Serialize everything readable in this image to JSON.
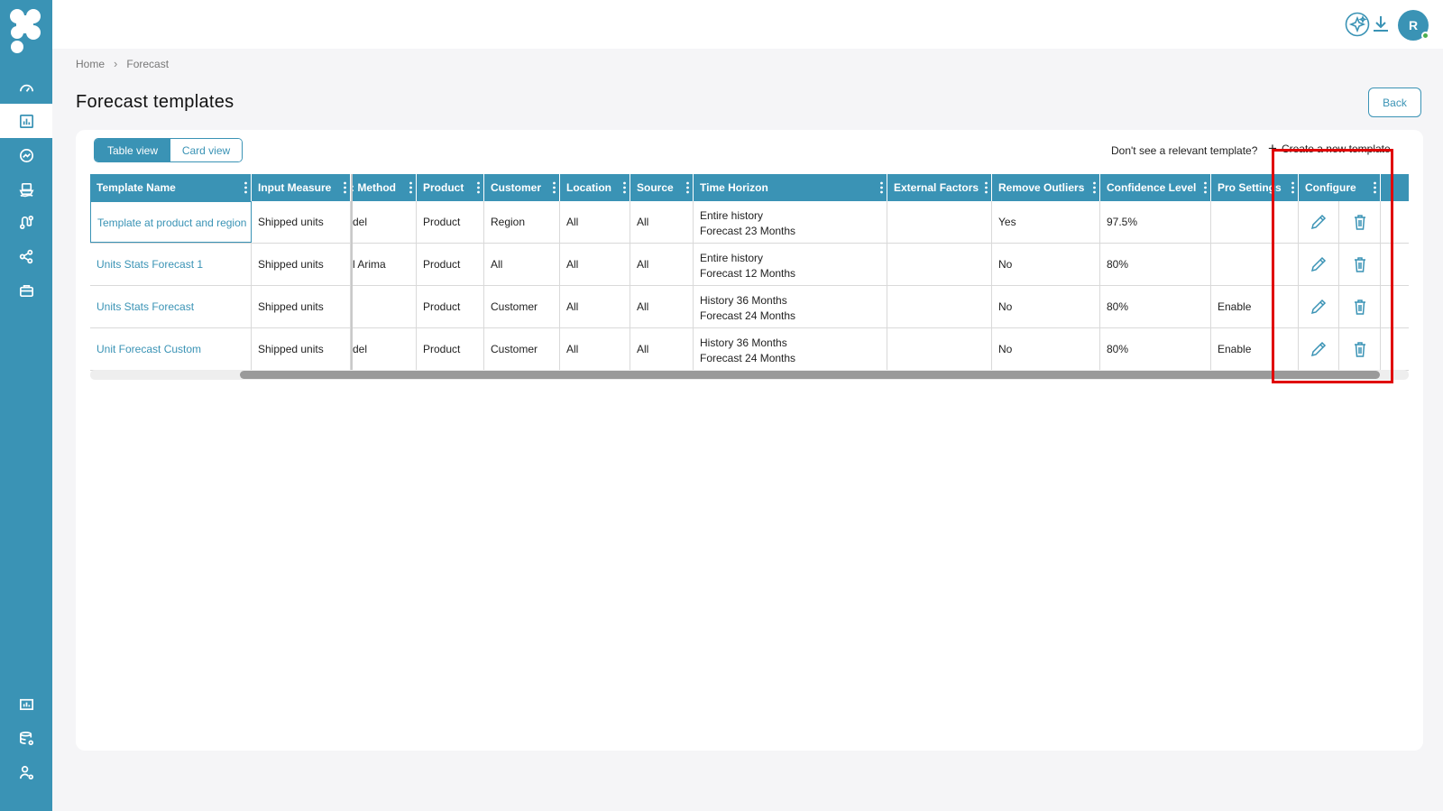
{
  "sidebar": {
    "logo": "flower-logo",
    "items": [
      {
        "icon": "dashboard-gauge-icon",
        "active": false
      },
      {
        "icon": "chart-report-icon",
        "active": true
      },
      {
        "icon": "trend-circle-icon",
        "active": false
      },
      {
        "icon": "ship-icon",
        "active": false
      },
      {
        "icon": "route-icon",
        "active": false
      },
      {
        "icon": "network-icon",
        "active": false
      },
      {
        "icon": "briefcase-icon",
        "active": false
      }
    ],
    "bottom_items": [
      {
        "icon": "analytics-icon"
      },
      {
        "icon": "database-settings-icon"
      },
      {
        "icon": "user-settings-icon"
      }
    ]
  },
  "topbar": {
    "ai_icon": "sparkle-icon",
    "download_icon": "download-icon",
    "avatar_initial": "R"
  },
  "breadcrumb": [
    "Home",
    "Forecast"
  ],
  "page_title": "Forecast templates",
  "back_label": "Back",
  "view_toggle": {
    "active": "Table view",
    "inactive": "Card view"
  },
  "hint_text": "Don't see a relevant template?",
  "create_label": "Create a new template",
  "table": {
    "headers": [
      "Template Name",
      "Input Measure",
      ": Method",
      "Product",
      "Customer",
      "Location",
      "Source",
      "Time Horizon",
      "External Factors",
      "Remove Outliers",
      "Confidence Level",
      "Pro Settings",
      "Configure"
    ],
    "rows": [
      {
        "name": "Template at product and region",
        "input": "Shipped units",
        "method": "del",
        "product": "Product",
        "customer": "Region",
        "location": "All",
        "source": "All",
        "horizon1": "Entire history",
        "horizon2": "Forecast 23 Months",
        "external": "",
        "outliers": "Yes",
        "confidence": "97.5%",
        "pro": ""
      },
      {
        "name": "Units Stats Forecast 1",
        "input": "Shipped units",
        "method": "l Arima",
        "product": "Product",
        "customer": "All",
        "location": "All",
        "source": "All",
        "horizon1": "Entire history",
        "horizon2": "Forecast 12 Months",
        "external": "",
        "outliers": "No",
        "confidence": "80%",
        "pro": ""
      },
      {
        "name": "Units Stats Forecast",
        "input": "Shipped units",
        "method": "",
        "product": "Product",
        "customer": "Customer",
        "location": "All",
        "source": "All",
        "horizon1": "History 36 Months",
        "horizon2": "Forecast 24 Months",
        "external": "",
        "outliers": "No",
        "confidence": "80%",
        "pro": "Enable"
      },
      {
        "name": "Unit Forecast Custom",
        "input": "Shipped units",
        "method": "del",
        "product": "Product",
        "customer": "Customer",
        "location": "All",
        "source": "All",
        "horizon1": "History 36 Months",
        "horizon2": "Forecast 24 Months",
        "external": "",
        "outliers": "No",
        "confidence": "80%",
        "pro": "Enable"
      }
    ]
  },
  "colors": {
    "brand": "#3a93b5",
    "highlight": "#e00000"
  }
}
